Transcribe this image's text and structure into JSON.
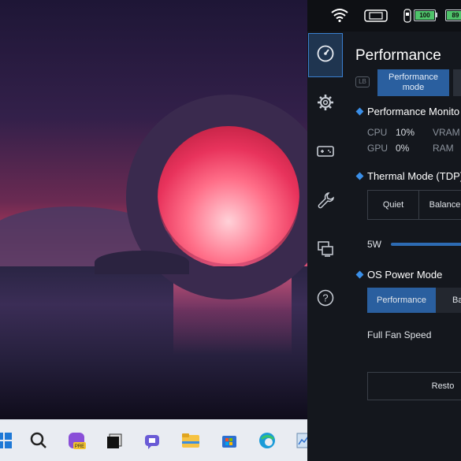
{
  "status_bar": {
    "battery_left": "100",
    "battery_right": "89",
    "battery_left_level": 1.0,
    "battery_right_level": 0.89
  },
  "sidebar": {
    "items": [
      {
        "icon": "speedometer-icon",
        "active": true
      },
      {
        "icon": "gear-icon",
        "active": false
      },
      {
        "icon": "gamepad-icon",
        "active": false
      },
      {
        "icon": "wrench-icon",
        "active": false
      },
      {
        "icon": "monitor-icon",
        "active": false
      },
      {
        "icon": "help-icon",
        "active": false
      }
    ]
  },
  "page": {
    "title": "Performance",
    "lb_label": "LB",
    "mode_tab_label": "Performance mode"
  },
  "monitor": {
    "title": "Performance Monito",
    "cpu_label": "CPU",
    "cpu_value": "10%",
    "gpu_label": "GPU",
    "gpu_value": "0%",
    "vram_label": "VRAM",
    "ram_label": "RAM"
  },
  "thermal": {
    "title": "Thermal Mode (TDP)",
    "quiet_label": "Quiet",
    "balance_label": "Balance",
    "slider_label": "5W"
  },
  "power": {
    "title": "OS Power Mode",
    "performance_label": "Performance",
    "second_label": "Ba"
  },
  "fan": {
    "label": "Full Fan Speed"
  },
  "restore": {
    "label": "Resto"
  },
  "taskbar": {
    "items": [
      "windows-start-icon",
      "search-icon",
      "copilot-icon",
      "task-view-icon",
      "teams-icon",
      "file-explorer-icon",
      "store-icon",
      "edge-icon",
      "app-icon"
    ]
  },
  "colors": {
    "accent": "#2a5f9f",
    "panel_bg": "#14171d",
    "diamond": "#3a8fe8"
  }
}
